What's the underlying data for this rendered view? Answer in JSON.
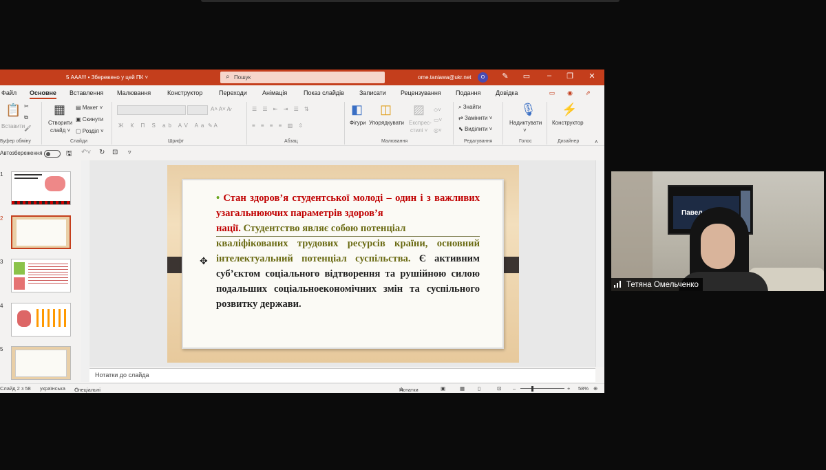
{
  "window": {
    "doc_title": "5 ААА!!! • Збережено у цей ПК ˅",
    "search_placeholder": "Пошук",
    "account": "ome.taniawa@ukr.net",
    "avatar_initial": "O"
  },
  "menu": [
    "Файл",
    "Основне",
    "Вставлення",
    "Малювання",
    "Конструктор",
    "Переходи",
    "Анімація",
    "Показ слайдів",
    "Записати",
    "Рецензування",
    "Подання",
    "Довідка"
  ],
  "ribbon": {
    "clipboard": {
      "paste": "Вставити",
      "label": "Буфер обміну"
    },
    "slides": {
      "new_slide_1": "Створити",
      "new_slide_2": "слайд ˅",
      "layout": "Макет ˅",
      "reset": "Скинути",
      "section": "Розділ ˅",
      "label": "Слайди"
    },
    "font": {
      "label": "Шрифт"
    },
    "paragraph": {
      "label": "Абзац"
    },
    "drawing": {
      "shapes": "Фігури",
      "arrange": "Упорядкувати",
      "quick_1": "Експрес-",
      "quick_2": "стилі ˅",
      "label": "Малювання"
    },
    "editing": {
      "find": "Знайти",
      "replace": "Замінити ˅",
      "select": "Виділити ˅",
      "label": "Редагування"
    },
    "voice": {
      "dictate": "Надиктувати",
      "label": "Голос"
    },
    "designer": {
      "designer": "Конструктор",
      "label": "Дизайнер"
    }
  },
  "qat": {
    "autosave": "Автозбереження"
  },
  "thumbnails": [
    {
      "num": "1"
    },
    {
      "num": "2"
    },
    {
      "num": "3"
    },
    {
      "num": "4"
    },
    {
      "num": "5"
    }
  ],
  "slide": {
    "line1a": "Стан здоров’я студентської молоді – один і з",
    "line1b": "важливих узагальнюючих параметрів здоров’я",
    "line1c": "нації.",
    "line2a": "Студентство являє собою потенціал",
    "line3": "кваліфікованих трудових ресурсів країни,",
    "line4": "основний інтелектуальний потенціал",
    "line5a": "суспільства.",
    "line5b": "Є активним суб’єктом соціального",
    "line6": "відтворення та рушійною силою подальших",
    "line7": "соціальноекономічних змін та суспільного",
    "line8": "розвитку держави."
  },
  "notes": {
    "placeholder": "Нотатки до слайда"
  },
  "status": {
    "slide": "Слайд 2 з 58",
    "lang": "українська",
    "accessibility": "Спеціальні можливості: щось не так",
    "notes": "Нотатки",
    "zoom": "58%"
  },
  "video": {
    "participant": "Тетяна Омельченко",
    "monitor_text": "Павел"
  },
  "colors": {
    "accent": "#c43e1c",
    "slide_red": "#c00000",
    "slide_olive": "#6b6b14"
  }
}
